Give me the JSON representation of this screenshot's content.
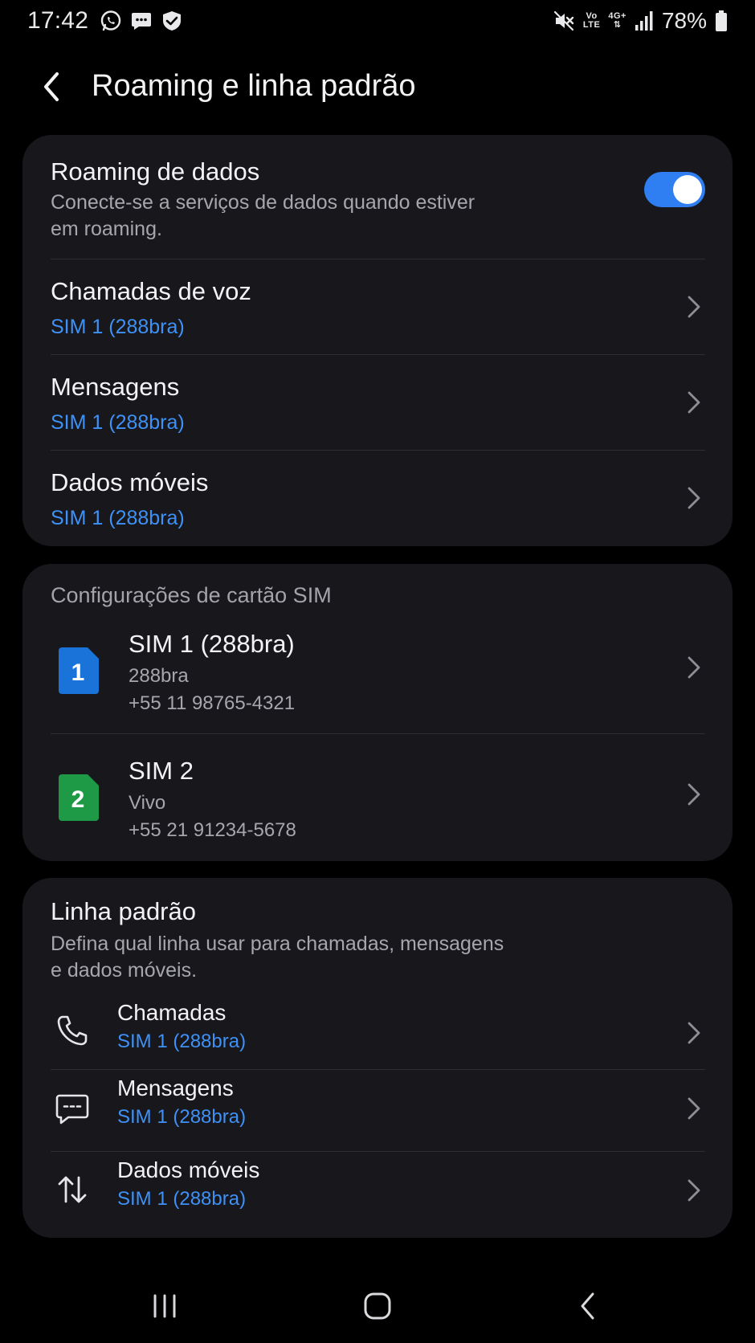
{
  "status_bar": {
    "time": "17:42",
    "left_icons": [
      "whatsapp-icon",
      "message-icon",
      "tracking-app-icon"
    ],
    "network_top": "Vo",
    "network_bottom": "LTE",
    "net_type": "4G+",
    "battery": "78%"
  },
  "header": {
    "title": "Roaming e linha padrão"
  },
  "roaming": {
    "title": "Roaming de dados",
    "description": "Conecte-se a serviços de dados quando estiver em roaming.",
    "enabled": true,
    "toggle_color": "#2f7ef2"
  },
  "roaming_items": [
    {
      "title": "Chamadas de voz",
      "value": "SIM 1 (288bra)"
    },
    {
      "title": "Mensagens",
      "value": "SIM 1 (288bra)"
    },
    {
      "title": "Dados móveis",
      "value": "SIM 1 (288bra)"
    }
  ],
  "sim_settings": {
    "section_title": "Configurações de cartão SIM",
    "sims": [
      {
        "icon_number": "1",
        "icon_color": "#1a73d9",
        "name": "SIM 1 (288bra)",
        "carrier": "288bra",
        "number": "+55 11 98765-4321"
      },
      {
        "icon_number": "2",
        "icon_color": "#1e9a47",
        "name": "SIM 2",
        "carrier": "Vivo",
        "number": "+55 21 91234-5678"
      }
    ]
  },
  "default_line": {
    "title": "Linha padrão",
    "description": "Defina qual linha usar para chamadas, mensagens e dados móveis.",
    "items": [
      {
        "icon": "phone-icon",
        "title": "Chamadas",
        "value": "SIM 1 (288bra)"
      },
      {
        "icon": "message-icon",
        "title": "Mensagens",
        "value": "SIM 1 (288bra)"
      },
      {
        "icon": "data-transfer-icon",
        "title": "Dados móveis",
        "value": "SIM 1 (288bra)"
      }
    ]
  },
  "nav_bar": {
    "buttons": [
      "recents-icon",
      "home-icon",
      "back-icon"
    ]
  },
  "colors": {
    "accent": "#3e91f6",
    "card_bg": "#17171c",
    "background": "#000000"
  }
}
